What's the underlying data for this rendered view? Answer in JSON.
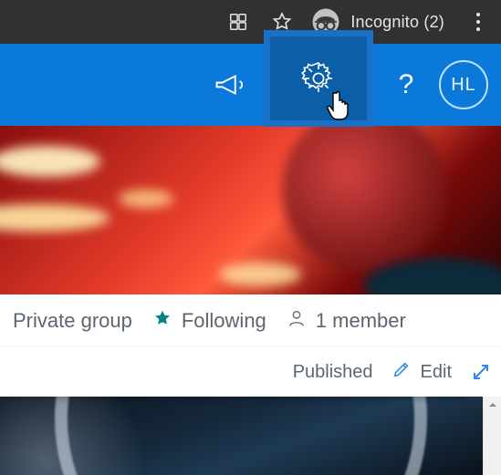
{
  "browser": {
    "incognito_label": "Incognito (2)",
    "icons": {
      "reader": "reader-icon",
      "star": "star-icon",
      "incognito": "incognito-icon",
      "menu": "menu-icon"
    }
  },
  "header": {
    "icons": {
      "megaphone": "megaphone-icon",
      "settings": "gear-icon",
      "help": "help-icon"
    },
    "help_symbol": "?",
    "avatar_initials": "HL"
  },
  "info": {
    "privacy": "Private group",
    "following_label": "Following",
    "members_label": "1 member"
  },
  "actions": {
    "status": "Published",
    "edit_label": "Edit"
  }
}
